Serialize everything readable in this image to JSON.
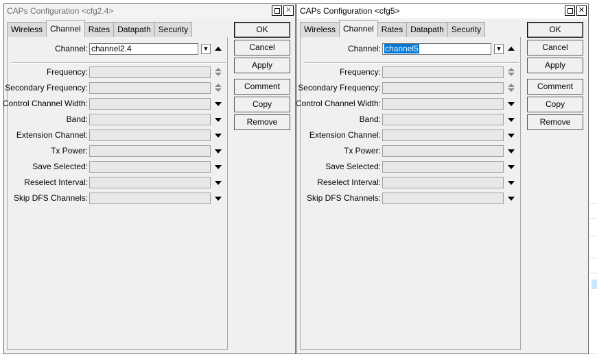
{
  "windows": [
    {
      "title": "CAPs Configuration <cfg2.4>",
      "tabs": [
        "Wireless",
        "Channel",
        "Rates",
        "Datapath",
        "Security"
      ],
      "active_tab": "Channel",
      "channel_label": "Channel:",
      "channel_value": "channel2.4",
      "fields": [
        {
          "label": "Frequency:",
          "value": ""
        },
        {
          "label": "Secondary Frequency:",
          "value": ""
        },
        {
          "label": "Control Channel Width:",
          "value": ""
        },
        {
          "label": "Band:",
          "value": ""
        },
        {
          "label": "Extension Channel:",
          "value": ""
        },
        {
          "label": "Tx Power:",
          "value": ""
        },
        {
          "label": "Save Selected:",
          "value": ""
        },
        {
          "label": "Reselect Interval:",
          "value": ""
        },
        {
          "label": "Skip DFS Channels:",
          "value": ""
        }
      ],
      "buttons": [
        "OK",
        "Cancel",
        "Apply",
        "Comment",
        "Copy",
        "Remove"
      ]
    },
    {
      "title": "CAPs Configuration <cfg5>",
      "tabs": [
        "Wireless",
        "Channel",
        "Rates",
        "Datapath",
        "Security"
      ],
      "active_tab": "Channel",
      "channel_label": "Channel:",
      "channel_value": "channel5",
      "fields": [
        {
          "label": "Frequency:",
          "value": ""
        },
        {
          "label": "Secondary Frequency:",
          "value": ""
        },
        {
          "label": "Control Channel Width:",
          "value": ""
        },
        {
          "label": "Band:",
          "value": ""
        },
        {
          "label": "Extension Channel:",
          "value": ""
        },
        {
          "label": "Tx Power:",
          "value": ""
        },
        {
          "label": "Save Selected:",
          "value": ""
        },
        {
          "label": "Reselect Interval:",
          "value": ""
        },
        {
          "label": "Skip DFS Channels:",
          "value": ""
        }
      ],
      "buttons": [
        "OK",
        "Cancel",
        "Apply",
        "Comment",
        "Copy",
        "Remove"
      ]
    }
  ],
  "icons": {
    "maximize": "maximize-icon",
    "close": "close-icon",
    "dropdown": "dropdown-icon",
    "collapse": "collapse-up-icon",
    "spinner": "spinner-icon"
  },
  "colors": {
    "selection": "#0078d7",
    "window_bg": "#f0f0f0"
  }
}
